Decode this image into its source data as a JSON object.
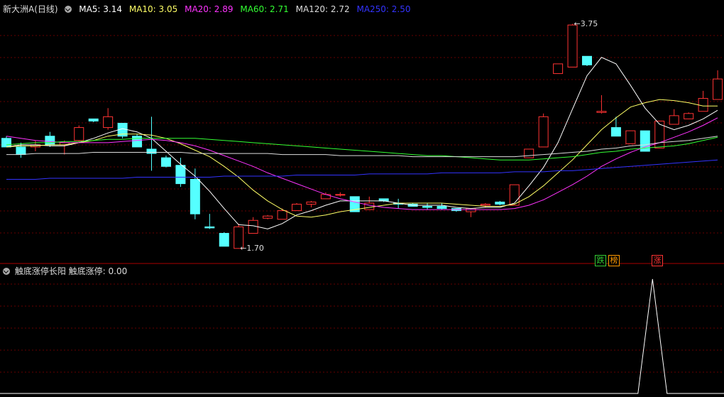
{
  "header": {
    "title": "新大洲A(日线)",
    "ma": [
      {
        "label": "MA5: 3.14",
        "color": "#ffffff"
      },
      {
        "label": "MA10: 3.05",
        "color": "#ffff66"
      },
      {
        "label": "MA20: 2.89",
        "color": "#ff33ff"
      },
      {
        "label": "MA60: 2.71",
        "color": "#33ff33"
      },
      {
        "label": "MA120: 2.72",
        "color": "#dddddd"
      },
      {
        "label": "MA250: 2.50",
        "color": "#3333ff"
      }
    ]
  },
  "markers": {
    "high": "3.75",
    "low": "1.70"
  },
  "badges": [
    {
      "text": "跌",
      "color": "#33cc33"
    },
    {
      "text": "榜",
      "color": "#ff9900"
    },
    {
      "text": "涨",
      "color": "#ff3333"
    }
  ],
  "indicator": {
    "name": "触底涨停长阳",
    "value_label": "触底涨停: 0.00"
  },
  "colors": {
    "up": "#ff3333",
    "down": "#55ffff",
    "grid": "#660000"
  },
  "chart_data": {
    "type": "candlestick",
    "candles": [
      [
        2.7,
        2.72,
        2.62,
        2.62
      ],
      [
        2.62,
        2.66,
        2.52,
        2.55
      ],
      [
        2.62,
        2.68,
        2.58,
        2.64
      ],
      [
        2.72,
        2.76,
        2.62,
        2.64
      ],
      [
        2.64,
        2.68,
        2.55,
        2.66
      ],
      [
        2.68,
        2.82,
        2.66,
        2.8
      ],
      [
        2.88,
        2.88,
        2.85,
        2.86
      ],
      [
        2.8,
        2.98,
        2.78,
        2.9
      ],
      [
        2.84,
        2.84,
        2.7,
        2.72
      ],
      [
        2.72,
        2.74,
        2.62,
        2.62
      ],
      [
        2.6,
        2.9,
        2.4,
        2.56
      ],
      [
        2.52,
        2.54,
        2.43,
        2.44
      ],
      [
        2.45,
        2.52,
        2.25,
        2.28
      ],
      [
        2.32,
        2.42,
        1.95,
        2.0
      ],
      [
        1.88,
        2.0,
        1.86,
        1.87
      ],
      [
        1.82,
        1.83,
        1.7,
        1.7
      ],
      [
        1.68,
        1.91,
        1.68,
        1.88
      ],
      [
        1.82,
        1.97,
        1.82,
        1.94
      ],
      [
        1.96,
        1.99,
        1.95,
        1.98
      ],
      [
        1.95,
        2.05,
        1.95,
        2.03
      ],
      [
        2.03,
        2.1,
        2.03,
        2.09
      ],
      [
        2.09,
        2.12,
        2.06,
        2.11
      ],
      [
        2.14,
        2.2,
        2.14,
        2.18
      ],
      [
        2.18,
        2.2,
        2.16,
        2.18
      ],
      [
        2.16,
        2.16,
        2.02,
        2.02
      ],
      [
        2.04,
        2.16,
        2.04,
        2.1
      ],
      [
        2.14,
        2.14,
        2.11,
        2.12
      ],
      [
        2.1,
        2.14,
        2.05,
        2.09
      ],
      [
        2.09,
        2.1,
        2.07,
        2.07
      ],
      [
        2.07,
        2.1,
        2.04,
        2.06
      ],
      [
        2.07,
        2.1,
        2.04,
        2.05
      ],
      [
        2.05,
        2.05,
        2.02,
        2.03
      ],
      [
        2.02,
        2.05,
        1.97,
        2.05
      ],
      [
        2.08,
        2.1,
        2.06,
        2.09
      ],
      [
        2.11,
        2.12,
        2.08,
        2.09
      ],
      [
        2.08,
        2.27,
        2.08,
        2.27
      ],
      [
        2.52,
        2.6,
        2.52,
        2.6
      ],
      [
        2.62,
        2.93,
        2.62,
        2.9
      ],
      [
        3.3,
        3.39,
        3.3,
        3.39
      ],
      [
        3.36,
        3.76,
        3.36,
        3.75
      ],
      [
        3.46,
        3.46,
        3.37,
        3.38
      ],
      [
        2.94,
        3.1,
        2.93,
        2.95
      ],
      [
        2.8,
        2.9,
        2.72,
        2.72
      ],
      [
        2.65,
        2.76,
        2.65,
        2.77
      ],
      [
        2.77,
        2.77,
        2.58,
        2.58
      ],
      [
        2.61,
        2.83,
        2.61,
        2.86
      ],
      [
        2.83,
        2.97,
        2.83,
        2.91
      ],
      [
        2.88,
        2.94,
        2.88,
        2.93
      ],
      [
        2.95,
        3.14,
        2.95,
        3.07
      ],
      [
        3.06,
        3.33,
        3.06,
        3.25
      ]
    ],
    "ma": {
      "MA5": [
        2.62,
        2.64,
        2.64,
        2.63,
        2.63,
        2.66,
        2.7,
        2.75,
        2.79,
        2.76,
        2.7,
        2.58,
        2.46,
        2.35,
        2.21,
        2.05,
        1.9,
        1.89,
        1.86,
        1.91,
        1.99,
        2.03,
        2.08,
        2.12,
        2.12,
        2.12,
        2.12,
        2.1,
        2.08,
        2.08,
        2.08,
        2.06,
        2.05,
        2.06,
        2.06,
        2.1,
        2.26,
        2.43,
        2.66,
        2.97,
        3.28,
        3.45,
        3.39,
        3.19,
        2.98,
        2.83,
        2.78,
        2.82,
        2.88,
        2.96
      ],
      "MA10": [
        2.62,
        2.63,
        2.63,
        2.64,
        2.64,
        2.66,
        2.68,
        2.72,
        2.74,
        2.74,
        2.73,
        2.7,
        2.65,
        2.59,
        2.53,
        2.44,
        2.34,
        2.22,
        2.12,
        2.04,
        1.98,
        1.97,
        1.99,
        2.02,
        2.04,
        2.06,
        2.08,
        2.1,
        2.1,
        2.1,
        2.1,
        2.09,
        2.08,
        2.07,
        2.07,
        2.09,
        2.16,
        2.26,
        2.38,
        2.5,
        2.64,
        2.78,
        2.89,
        2.99,
        3.03,
        3.06,
        3.05,
        3.03,
        3.0,
        3.0
      ],
      "MA20": [
        2.72,
        2.7,
        2.68,
        2.67,
        2.66,
        2.66,
        2.66,
        2.66,
        2.67,
        2.68,
        2.69,
        2.68,
        2.66,
        2.63,
        2.59,
        2.54,
        2.49,
        2.44,
        2.38,
        2.33,
        2.28,
        2.23,
        2.18,
        2.14,
        2.11,
        2.08,
        2.06,
        2.05,
        2.04,
        2.04,
        2.04,
        2.04,
        2.04,
        2.04,
        2.04,
        2.05,
        2.08,
        2.13,
        2.2,
        2.27,
        2.35,
        2.44,
        2.51,
        2.57,
        2.62,
        2.66,
        2.71,
        2.76,
        2.82,
        2.89
      ],
      "MA60": [
        2.64,
        2.65,
        2.66,
        2.66,
        2.67,
        2.67,
        2.68,
        2.69,
        2.69,
        2.7,
        2.7,
        2.7,
        2.7,
        2.7,
        2.69,
        2.68,
        2.67,
        2.66,
        2.65,
        2.64,
        2.63,
        2.62,
        2.61,
        2.6,
        2.59,
        2.58,
        2.57,
        2.56,
        2.55,
        2.54,
        2.54,
        2.53,
        2.52,
        2.51,
        2.5,
        2.5,
        2.5,
        2.51,
        2.52,
        2.53,
        2.55,
        2.57,
        2.58,
        2.6,
        2.61,
        2.62,
        2.63,
        2.65,
        2.68,
        2.71
      ],
      "MA120": [
        2.55,
        2.55,
        2.56,
        2.56,
        2.56,
        2.56,
        2.57,
        2.57,
        2.57,
        2.57,
        2.57,
        2.57,
        2.57,
        2.56,
        2.56,
        2.56,
        2.56,
        2.56,
        2.56,
        2.55,
        2.55,
        2.55,
        2.55,
        2.54,
        2.54,
        2.54,
        2.54,
        2.54,
        2.53,
        2.53,
        2.53,
        2.53,
        2.53,
        2.53,
        2.53,
        2.53,
        2.54,
        2.55,
        2.56,
        2.57,
        2.58,
        2.6,
        2.61,
        2.63,
        2.64,
        2.66,
        2.67,
        2.68,
        2.7,
        2.72
      ],
      "MA250": [
        2.32,
        2.32,
        2.32,
        2.33,
        2.33,
        2.33,
        2.33,
        2.33,
        2.33,
        2.34,
        2.34,
        2.34,
        2.34,
        2.34,
        2.34,
        2.35,
        2.35,
        2.35,
        2.35,
        2.35,
        2.36,
        2.36,
        2.36,
        2.36,
        2.36,
        2.37,
        2.37,
        2.37,
        2.37,
        2.37,
        2.38,
        2.38,
        2.38,
        2.38,
        2.38,
        2.39,
        2.39,
        2.39,
        2.4,
        2.4,
        2.41,
        2.42,
        2.43,
        2.44,
        2.45,
        2.46,
        2.47,
        2.48,
        2.49,
        2.5
      ]
    },
    "indicator_series": [
      0,
      0,
      0,
      0,
      0,
      0,
      0,
      0,
      0,
      0,
      0,
      0,
      0,
      0,
      0,
      0,
      0,
      0,
      0,
      0,
      0,
      0,
      0,
      0,
      0,
      0,
      0,
      0,
      0,
      0,
      0,
      0,
      0,
      0,
      0,
      0,
      0,
      0,
      0,
      0,
      0,
      0,
      0,
      0,
      0,
      1,
      0,
      0,
      0,
      0
    ],
    "price_range": [
      1.58,
      3.85
    ]
  }
}
